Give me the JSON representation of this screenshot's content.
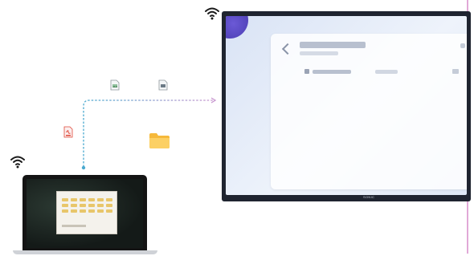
{
  "scene": {
    "display_brand": "SONIC",
    "icons": {
      "wifi_display": "wifi-icon",
      "wifi_laptop": "wifi-icon",
      "file_image": "image-file-icon",
      "file_doc": "document-file-icon",
      "file_pdf": "pdf-file-icon",
      "folder": "folder-icon"
    },
    "colors": {
      "connection_laptop": "#4aa9cf",
      "connection_display": "#c896cf",
      "folder": "#f6b93b",
      "pdf": "#e04a3a"
    }
  }
}
